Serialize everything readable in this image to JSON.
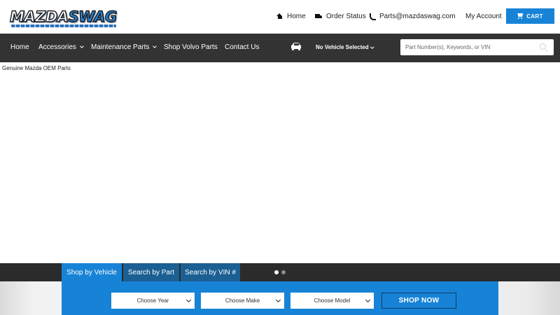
{
  "header": {
    "logo": {
      "text_main": "MAZDA",
      "text_accent": "SWAG"
    },
    "links": {
      "home": "Home",
      "order_status": "Order Status",
      "email": "Parts@mazdaswag.com",
      "account": "My Account"
    },
    "cart_label": "CART"
  },
  "nav": {
    "items": [
      {
        "label": "Home",
        "dropdown": false
      },
      {
        "label": "Accessories",
        "dropdown": true
      },
      {
        "label": "Maintenance Parts",
        "dropdown": true
      },
      {
        "label": "Shop Volvo Parts",
        "dropdown": false
      },
      {
        "label": "Contact Us",
        "dropdown": false
      }
    ],
    "vehicle_selector": "No Vehicle Selected",
    "search_placeholder": "Part Number(s), Keywords, or VIN"
  },
  "breadcrumb": "Genuine Mazda OEM Parts",
  "finder": {
    "tabs": [
      {
        "label": "Shop by Vehicle",
        "active": true
      },
      {
        "label": "Search by Part",
        "active": false
      },
      {
        "label": "Search by VIN #",
        "active": false
      }
    ],
    "selects": {
      "year": "Choose Year",
      "make": "Choose Make",
      "model": "Choose Model"
    },
    "shop_button": "SHOP NOW"
  },
  "slider": {
    "slide_count": 2,
    "active_index": 0
  },
  "colors": {
    "primary_blue": "#1783d6",
    "tab_inactive": "#1b5f93",
    "nav_bg": "#333333",
    "strip_bg": "#2b2b2b"
  },
  "icons": {
    "home": "house-icon",
    "order": "truck-icon",
    "email": "phone-icon",
    "cart": "cart-icon",
    "vehicle": "car-icon",
    "search": "search-icon"
  }
}
